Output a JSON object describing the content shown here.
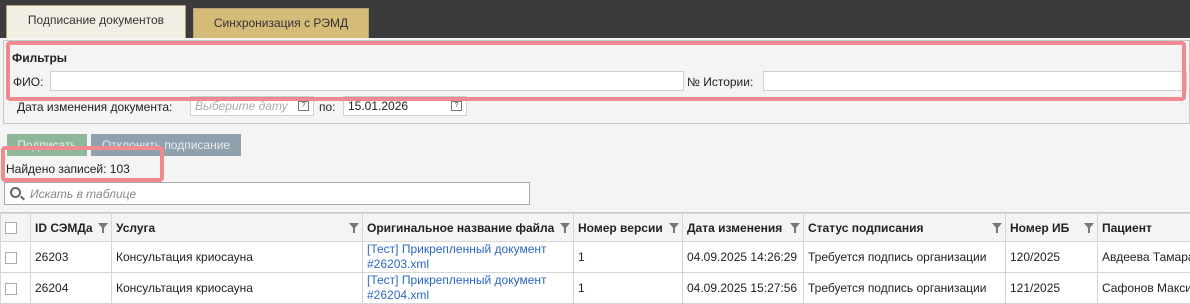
{
  "tabs": [
    {
      "label": "Подписание документов",
      "active": true
    },
    {
      "label": "Синхронизация с РЭМД",
      "active": false
    }
  ],
  "filters": {
    "title": "Фильтры",
    "fio_label": "ФИО:",
    "fio_value": "",
    "history_label": "№ Истории:",
    "history_value": "",
    "date_label": "Дата изменения документа:",
    "date_from_placeholder": "Выберите дату",
    "date_to_label": "по:",
    "date_to_value": "15.01.2026"
  },
  "actions": {
    "sign": "Подписать",
    "reject": "Отклонить подписание"
  },
  "found_text": "Найдено записей: 103",
  "search": {
    "placeholder": "Искать в таблице"
  },
  "table": {
    "columns": [
      "ID СЭМДа",
      "Услуга",
      "Оригинальное название файла",
      "Номер версии",
      "Дата изменения",
      "Статус подписания",
      "Номер ИБ",
      "Пациент"
    ],
    "rows": [
      {
        "id": "26203",
        "service": "Консультация криосауна",
        "doc": "[Тест] Прикрепленный документ #26203.xml",
        "version": "1",
        "date": "04.09.2025 14:26:29",
        "status": "Требуется подпись организации",
        "ib": "120/2025",
        "patient": "Авдеева Тамара"
      },
      {
        "id": "26204",
        "service": "Консультация криосауна",
        "doc": "[Тест] Прикрепленный документ #26204.xml",
        "version": "1",
        "date": "04.09.2025 15:27:56",
        "status": "Требуется подпись организации",
        "ib": "121/2025",
        "patient": "Сафонов Максим"
      }
    ]
  },
  "colors": {
    "header_bg": "#3b3b3b",
    "active_tab": "#f2eee3",
    "inactive_tab": "#d4bb78",
    "highlight": "#f08a8f",
    "link": "#2b66c4"
  }
}
